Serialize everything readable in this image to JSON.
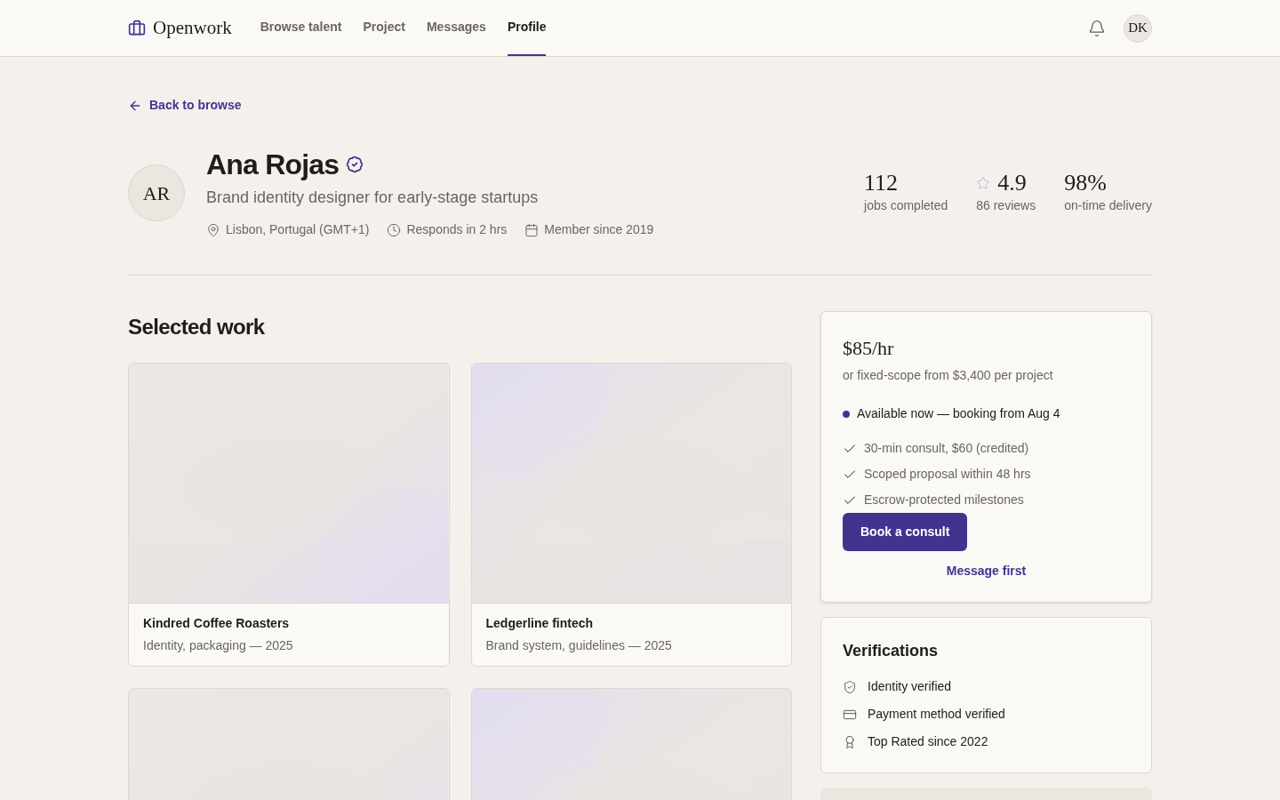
{
  "brand": "Openwork",
  "nav": [
    {
      "label": "Browse talent",
      "selected": false
    },
    {
      "label": "Project",
      "selected": false
    },
    {
      "label": "Messages",
      "selected": false
    },
    {
      "label": "Profile",
      "selected": true
    }
  ],
  "user_initials": "DK",
  "back_link": "Back to browse",
  "profile": {
    "initials": "AR",
    "name": "Ana Rojas",
    "verified": true,
    "headline": "Brand identity designer for early-stage startups",
    "meta": [
      {
        "kind": "location",
        "text": "Lisbon, Portugal (GMT+1)"
      },
      {
        "kind": "clock",
        "text": "Responds in 2 hrs"
      },
      {
        "kind": "calendar",
        "text": "Member since 2019"
      }
    ]
  },
  "stats": [
    {
      "value": "112",
      "label": "jobs completed",
      "star": false
    },
    {
      "value": "4.9",
      "label": "86 reviews",
      "star": true
    },
    {
      "value": "98%",
      "label": "on-time delivery",
      "star": false
    }
  ],
  "work": {
    "title": "Selected work",
    "items": [
      {
        "kind": "card",
        "title": "Kindred Coffee Roasters",
        "subtitle": "Identity, packaging — 2025"
      },
      {
        "kind": "card",
        "title": "Ledgerline fintech",
        "subtitle": "Brand system, guidelines — 2025"
      },
      {
        "kind": "picture"
      },
      {
        "kind": "picture"
      }
    ]
  },
  "pricing": {
    "rate": "$85/hr",
    "note": "or fixed-scope from $3,400 per project",
    "availability": "Available now — booking from Aug 4",
    "available": true,
    "features": [
      "30-min consult, $60 (credited)",
      "Scoped proposal within 48 hrs",
      "Escrow-protected milestones"
    ],
    "primary_button": "Book a consult",
    "secondary_link": "Message first"
  },
  "verifications": {
    "title": "Verifications",
    "items": [
      {
        "kind": "shield",
        "text": "Identity verified"
      },
      {
        "kind": "card",
        "text": "Payment method verified"
      },
      {
        "kind": "award",
        "text": "Top Rated since 2022"
      }
    ]
  }
}
